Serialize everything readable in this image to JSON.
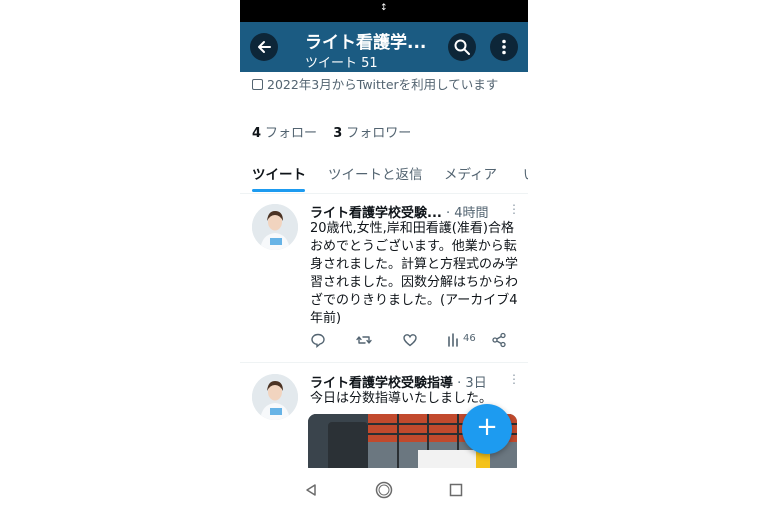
{
  "header": {
    "title": "ライト看護学...",
    "subtitle": "ツイート 51"
  },
  "profile": {
    "joined": "2022年3月からTwitterを利用しています",
    "following_count": "4",
    "following_label": "フォロー",
    "followers_count": "3",
    "followers_label": "フォロワー"
  },
  "tabs": [
    {
      "label": "ツイート",
      "active": true
    },
    {
      "label": "ツイートと返信",
      "active": false
    },
    {
      "label": "メディア",
      "active": false
    },
    {
      "label": "い",
      "active": false
    }
  ],
  "tweets": [
    {
      "name": "ライト看護学校受験...",
      "time": "· 4時間",
      "text": "20歳代,女性,岸和田看護(准看)合格おめでとうございます。他業から転身されました。計算と方程式のみ学習されました。因数分解はちからわざでのりきりました。(アーカイブ4年前)",
      "views": "46"
    },
    {
      "name": "ライト看護学校受験指導",
      "time": "· 3日",
      "text": "今日は分数指導いたしました。"
    }
  ],
  "colors": {
    "appbar": "#1b5b82",
    "accent": "#1d9bf0"
  }
}
